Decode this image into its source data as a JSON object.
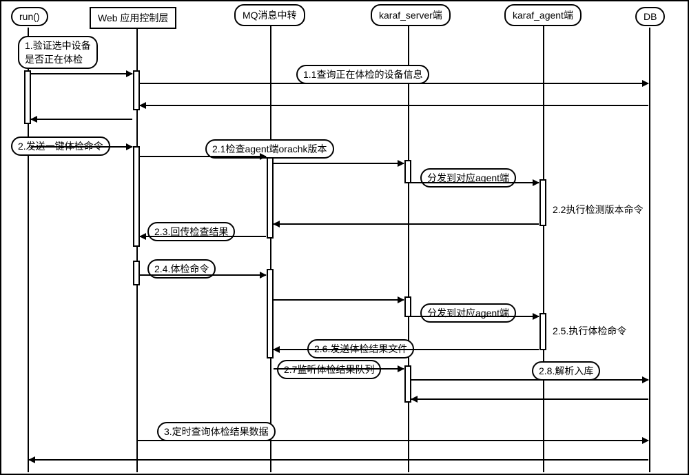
{
  "participants": {
    "run": "run()",
    "web": "Web 应用控制层",
    "mq": "MQ消息中转",
    "server": "karaf_server端",
    "agent": "karaf_agent端",
    "db": "DB"
  },
  "messages": {
    "m1": "1.验证选中设备\n是否正在体检",
    "m1_1": "1.1查询正在体检的设备信息",
    "m2": "2.发送一键体检命令",
    "m2_1": "2.1检查agent端orachk版本",
    "m2_1_d": "分发到对应agent端",
    "m2_2": "2.2执行检测版本命令",
    "m2_3": "2.3.回传检查结果",
    "m2_4": "2.4.体检命令",
    "m2_4_d": "分发到对应agent端",
    "m2_5": "2.5.执行体检命令",
    "m2_6": "2.6.发送体检结果文件",
    "m2_7": "2.7监听体检结果队列",
    "m2_8": "2.8.解析入库",
    "m3": "3.定时查询体检结果数据"
  },
  "chart_data": {
    "type": "sequence-diagram",
    "participants": [
      "run()",
      "Web 应用控制层",
      "MQ消息中转",
      "karaf_server端",
      "karaf_agent端",
      "DB"
    ],
    "interactions": [
      {
        "from": "run()",
        "to": "Web 应用控制层",
        "label": "1.验证选中设备是否正在体检"
      },
      {
        "from": "Web 应用控制层",
        "to": "DB",
        "label": "1.1查询正在体检的设备信息"
      },
      {
        "from": "DB",
        "to": "Web 应用控制层",
        "label": "",
        "return": true
      },
      {
        "from": "Web 应用控制层",
        "to": "run()",
        "label": "",
        "return": true
      },
      {
        "from": "run()",
        "to": "Web 应用控制层",
        "label": "2.发送一键体检命令"
      },
      {
        "from": "Web 应用控制层",
        "to": "MQ消息中转",
        "label": "2.1检查agent端orachk版本"
      },
      {
        "from": "MQ消息中转",
        "to": "karaf_server端",
        "label": ""
      },
      {
        "from": "karaf_server端",
        "to": "karaf_agent端",
        "label": "分发到对应agent端"
      },
      {
        "from": "karaf_agent端",
        "to": "karaf_agent端",
        "label": "2.2执行检测版本命令",
        "self": true
      },
      {
        "from": "karaf_agent端",
        "to": "MQ消息中转",
        "label": "2.3.回传检查结果"
      },
      {
        "from": "MQ消息中转",
        "to": "Web 应用控制层",
        "label": ""
      },
      {
        "from": "Web 应用控制层",
        "to": "MQ消息中转",
        "label": "2.4.体检命令"
      },
      {
        "from": "MQ消息中转",
        "to": "karaf_server端",
        "label": ""
      },
      {
        "from": "karaf_server端",
        "to": "karaf_agent端",
        "label": "分发到对应agent端"
      },
      {
        "from": "karaf_agent端",
        "to": "karaf_agent端",
        "label": "2.5.执行体检命令",
        "self": true
      },
      {
        "from": "karaf_agent端",
        "to": "MQ消息中转",
        "label": "2.6.发送体检结果文件"
      },
      {
        "from": "MQ消息中转",
        "to": "karaf_server端",
        "label": "2.7监听体检结果队列"
      },
      {
        "from": "karaf_server端",
        "to": "DB",
        "label": "2.8.解析入库"
      },
      {
        "from": "DB",
        "to": "karaf_server端",
        "label": "",
        "return": true
      },
      {
        "from": "Web 应用控制层",
        "to": "DB",
        "label": "3.定时查询体检结果数据"
      },
      {
        "from": "DB",
        "to": "run()",
        "label": "",
        "return": true
      }
    ]
  }
}
